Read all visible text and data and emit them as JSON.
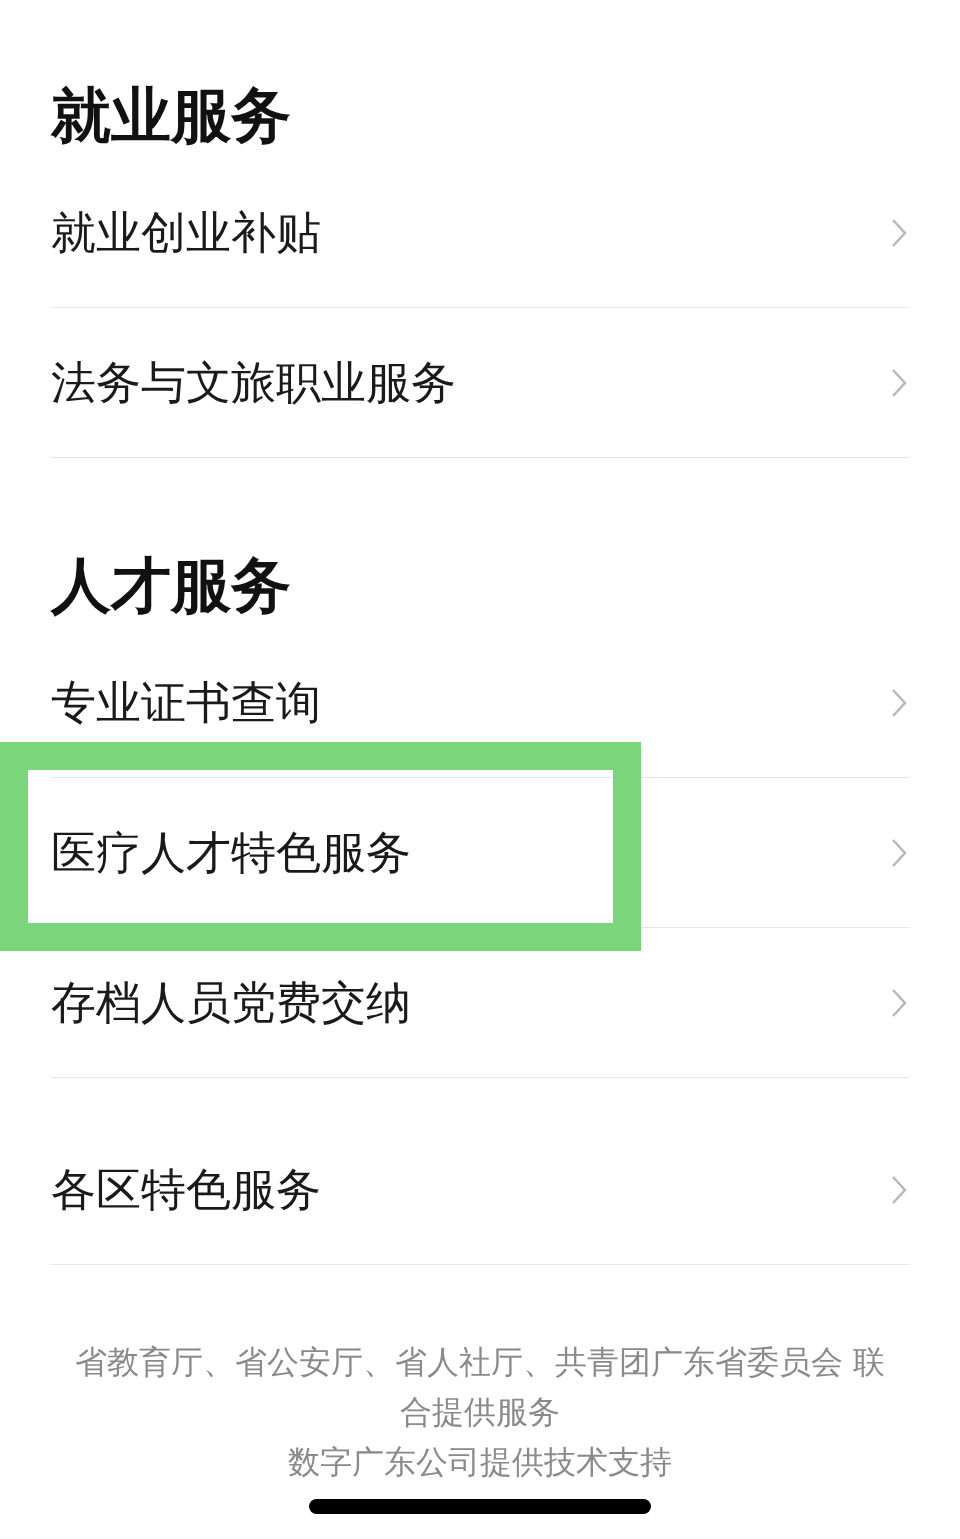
{
  "groups": [
    {
      "title": "就业服务",
      "items": [
        {
          "label": "就业创业补贴",
          "highlighted": false
        },
        {
          "label": "法务与文旅职业服务",
          "highlighted": false
        }
      ]
    },
    {
      "title": "人才服务",
      "items": [
        {
          "label": "专业证书查询",
          "highlighted": false
        },
        {
          "label": "医疗人才特色服务",
          "highlighted": true
        },
        {
          "label": "存档人员党费交纳",
          "highlighted": false
        }
      ]
    },
    {
      "items": [
        {
          "label": "各区特色服务",
          "highlighted": false
        }
      ]
    }
  ],
  "footer": [
    "省教育厅、省公安厅、省人社厅、共青团广东省委员会 联合提供服务",
    "数字广东公司提供技术支持"
  ]
}
